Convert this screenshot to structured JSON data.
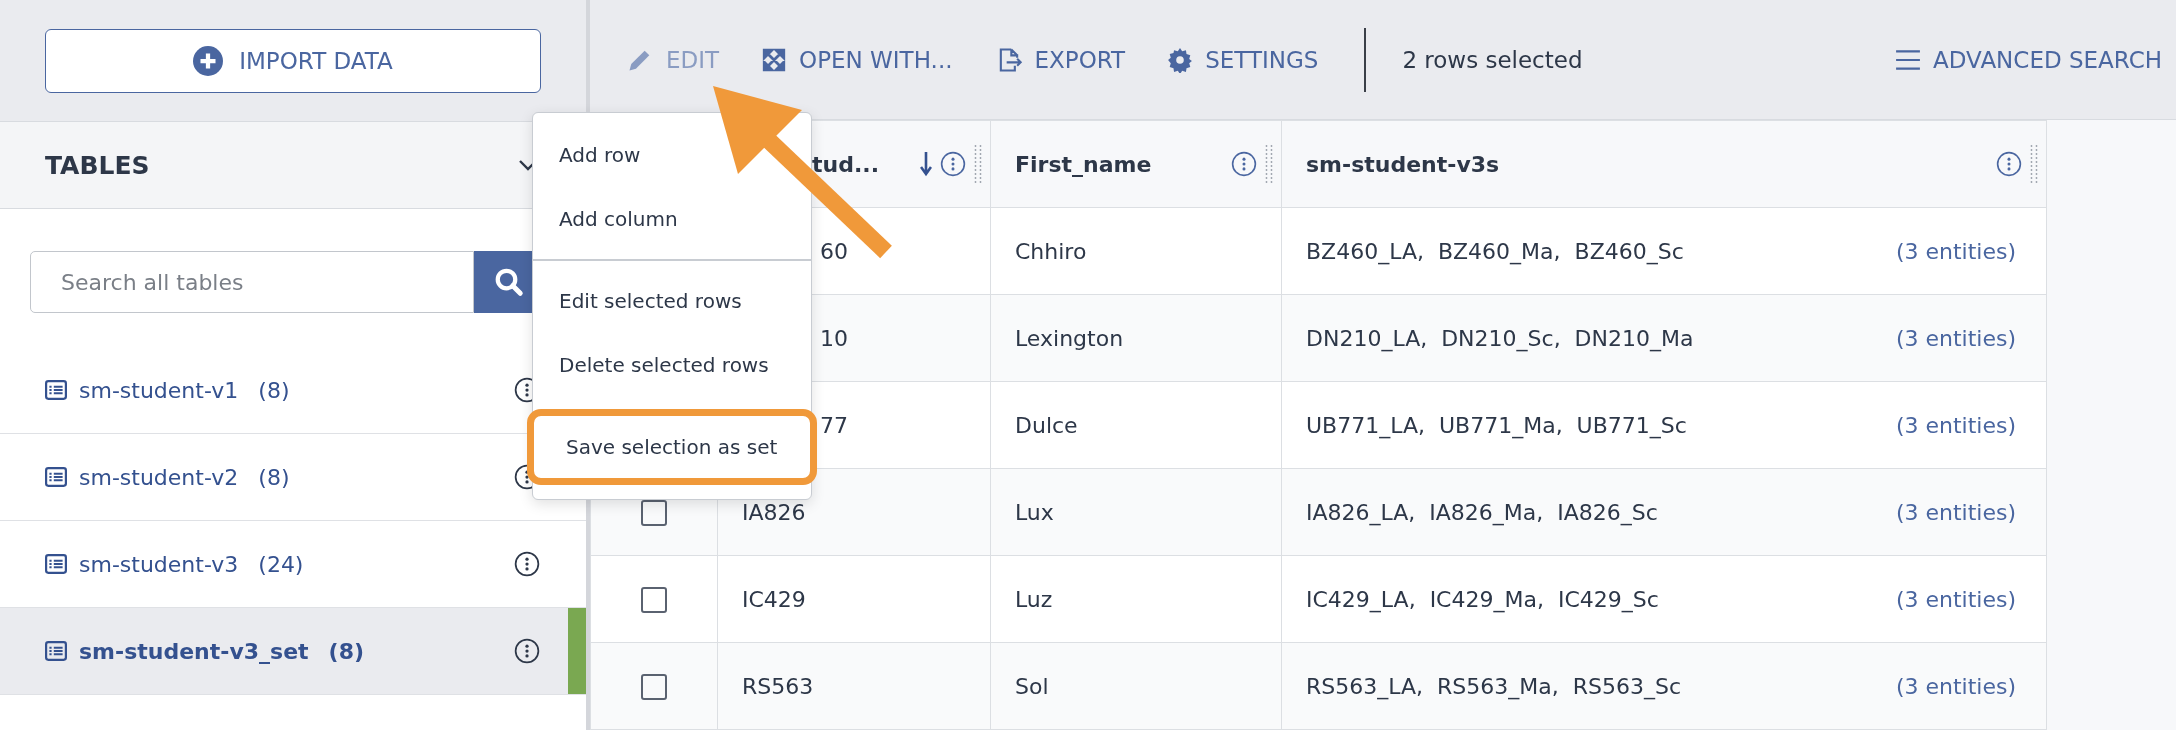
{
  "sidebar": {
    "import_button": "IMPORT DATA",
    "tables_header": "TABLES",
    "search": {
      "placeholder": "Search all tables"
    },
    "tables": [
      {
        "name": "sm-student-v1",
        "count": "(8)",
        "selected": false
      },
      {
        "name": "sm-student-v2",
        "count": "(8)",
        "selected": false
      },
      {
        "name": "sm-student-v3",
        "count": "(24)",
        "selected": false
      },
      {
        "name": "sm-student-v3_set",
        "count": "(8)",
        "selected": true
      }
    ]
  },
  "toolbar": {
    "actions": [
      {
        "label": "EDIT",
        "disabled": true
      },
      {
        "label": "OPEN WITH...",
        "disabled": false
      },
      {
        "label": "EXPORT",
        "disabled": false
      },
      {
        "label": "SETTINGS",
        "disabled": false
      }
    ],
    "selection_status": "2 rows selected",
    "advanced_search": "ADVANCED SEARCH"
  },
  "table": {
    "columns": [
      {
        "label": "tud...",
        "sorted": true
      },
      {
        "label": "First_name",
        "sorted": false
      },
      {
        "label": "sm-student-v3s",
        "sorted": false
      }
    ],
    "rows": [
      {
        "id": "60",
        "first_name": "Chhiro",
        "linked": "BZ460_LA,  BZ460_Ma,  BZ460_Sc",
        "linked_count": "(3 entities)"
      },
      {
        "id": "10",
        "first_name": "Lexington",
        "linked": "DN210_LA,  DN210_Sc,  DN210_Ma",
        "linked_count": "(3 entities)"
      },
      {
        "id": "77",
        "first_name": "Dulce",
        "linked": "UB771_LA,  UB771_Ma,  UB771_Sc",
        "linked_count": "(3 entities)"
      },
      {
        "id": "IA826",
        "checked": false,
        "first_name": "Lux",
        "linked": "IA826_LA,  IA826_Ma,  IA826_Sc",
        "linked_count": "(3 entities)"
      },
      {
        "id": "IC429",
        "checked": false,
        "first_name": "Luz",
        "linked": "IC429_LA,  IC429_Ma,  IC429_Sc",
        "linked_count": "(3 entities)"
      },
      {
        "id": "RS563",
        "checked": false,
        "first_name": "Sol",
        "linked": "RS563_LA,  RS563_Ma,  RS563_Sc",
        "linked_count": "(3 entities)"
      }
    ]
  },
  "context_menu": {
    "groups": [
      [
        {
          "label": "Add row",
          "highlighted": false
        },
        {
          "label": "Add column",
          "highlighted": false
        }
      ],
      [
        {
          "label": "Edit selected rows",
          "highlighted": false
        },
        {
          "label": "Delete selected rows",
          "highlighted": false
        },
        {
          "label": "Save selection as set",
          "highlighted": true
        }
      ]
    ]
  }
}
